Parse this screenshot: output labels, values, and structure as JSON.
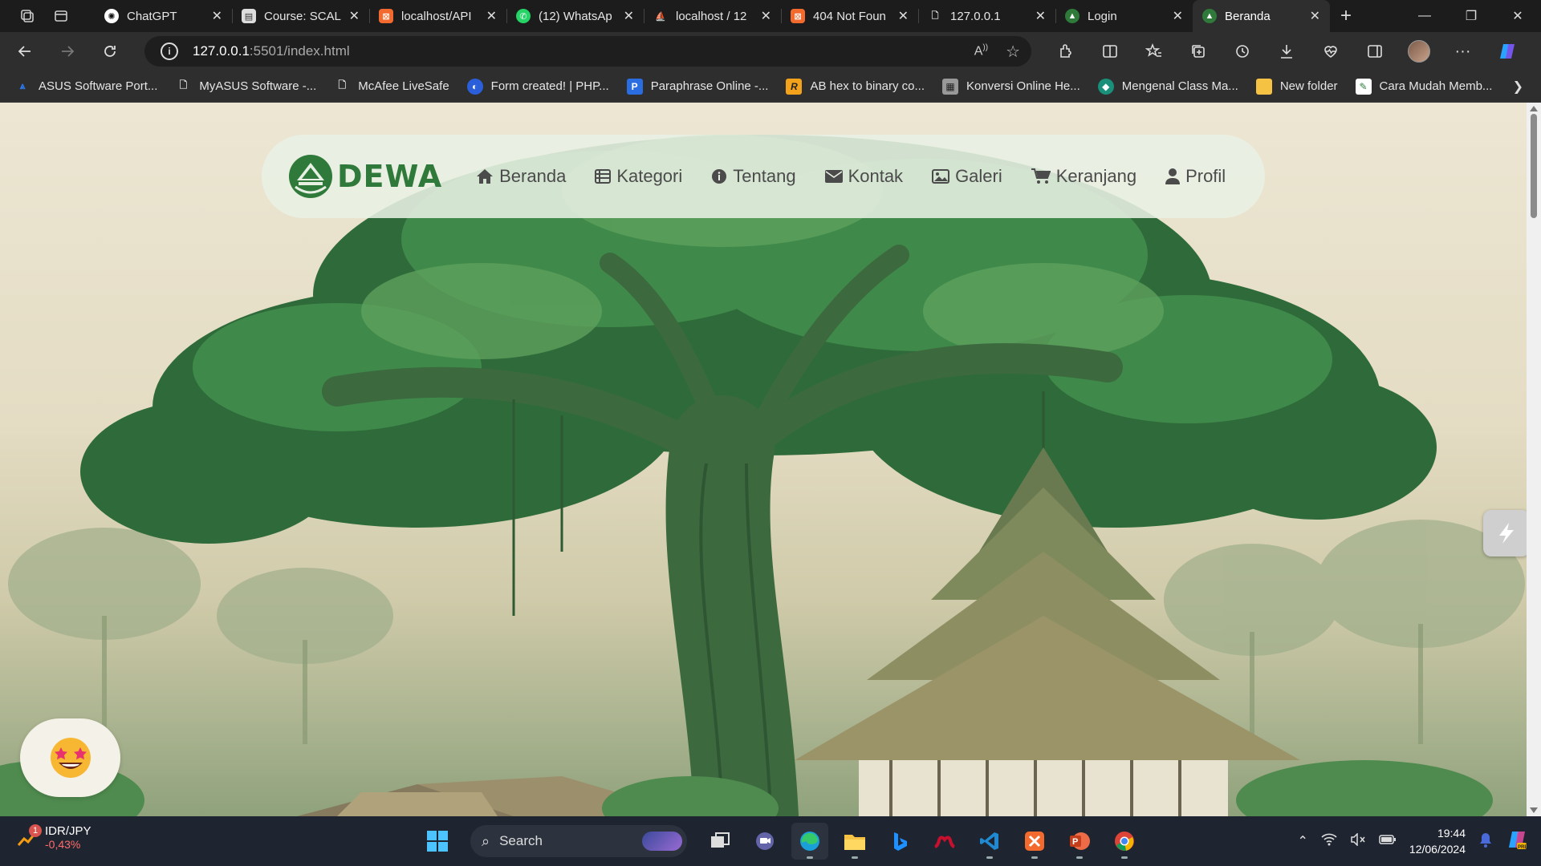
{
  "browser": {
    "tabs": [
      {
        "title": "ChatGPT",
        "favicon": "chatgpt-icon",
        "active": false
      },
      {
        "title": "Course: SCAL",
        "favicon": "course-icon",
        "active": false
      },
      {
        "title": "localhost/API",
        "favicon": "xampp-icon",
        "active": false
      },
      {
        "title": "(12) WhatsAp",
        "favicon": "whatsapp-icon",
        "active": false
      },
      {
        "title": "localhost / 12",
        "favicon": "phpmyadmin-icon",
        "active": false
      },
      {
        "title": "404 Not Foun",
        "favicon": "xampp-icon",
        "active": false
      },
      {
        "title": "127.0.0.1",
        "favicon": "file-icon",
        "active": false
      },
      {
        "title": "Login",
        "favicon": "site-logo-icon",
        "active": false
      },
      {
        "title": "Beranda",
        "favicon": "site-logo-icon",
        "active": true
      }
    ],
    "address": {
      "host": "127.0.0.1",
      "rest": ":5501/index.html"
    },
    "bookmarks": [
      {
        "label": "ASUS Software Port...",
        "icon": "asus-icon"
      },
      {
        "label": "MyASUS Software -...",
        "icon": "page-icon"
      },
      {
        "label": "McAfee LiveSafe",
        "icon": "page-icon"
      },
      {
        "label": "Form created! | PHP...",
        "icon": "form-icon"
      },
      {
        "label": "Paraphrase Online -...",
        "icon": "paraphrase-icon"
      },
      {
        "label": "AB hex to binary co...",
        "icon": "r-icon"
      },
      {
        "label": "Konversi Online He...",
        "icon": "calculator-icon"
      },
      {
        "label": "Mengenal Class Ma...",
        "icon": "site-icon"
      },
      {
        "label": "New folder",
        "icon": "folder-icon"
      },
      {
        "label": "Cara Mudah Memb...",
        "icon": "image-icon"
      }
    ]
  },
  "site": {
    "logo_text": "DEWA",
    "menu": [
      {
        "label": "Beranda",
        "icon": "home-icon"
      },
      {
        "label": "Kategori",
        "icon": "list-icon"
      },
      {
        "label": "Tentang",
        "icon": "info-icon"
      },
      {
        "label": "Kontak",
        "icon": "envelope-icon"
      },
      {
        "label": "Galeri",
        "icon": "image-icon"
      },
      {
        "label": "Keranjang",
        "icon": "cart-icon"
      },
      {
        "label": "Profil",
        "icon": "user-icon"
      }
    ]
  },
  "taskbar": {
    "ticker_symbol": "IDR/JPY",
    "ticker_change": "-0,43%",
    "ticker_badge": "1",
    "search_label": "Search",
    "time": "19:44",
    "date": "12/06/2024"
  },
  "colors": {
    "brand_green": "#2f7a3a",
    "nav_text": "#4b4b4b",
    "ticker_negative": "#ff6b6b"
  }
}
